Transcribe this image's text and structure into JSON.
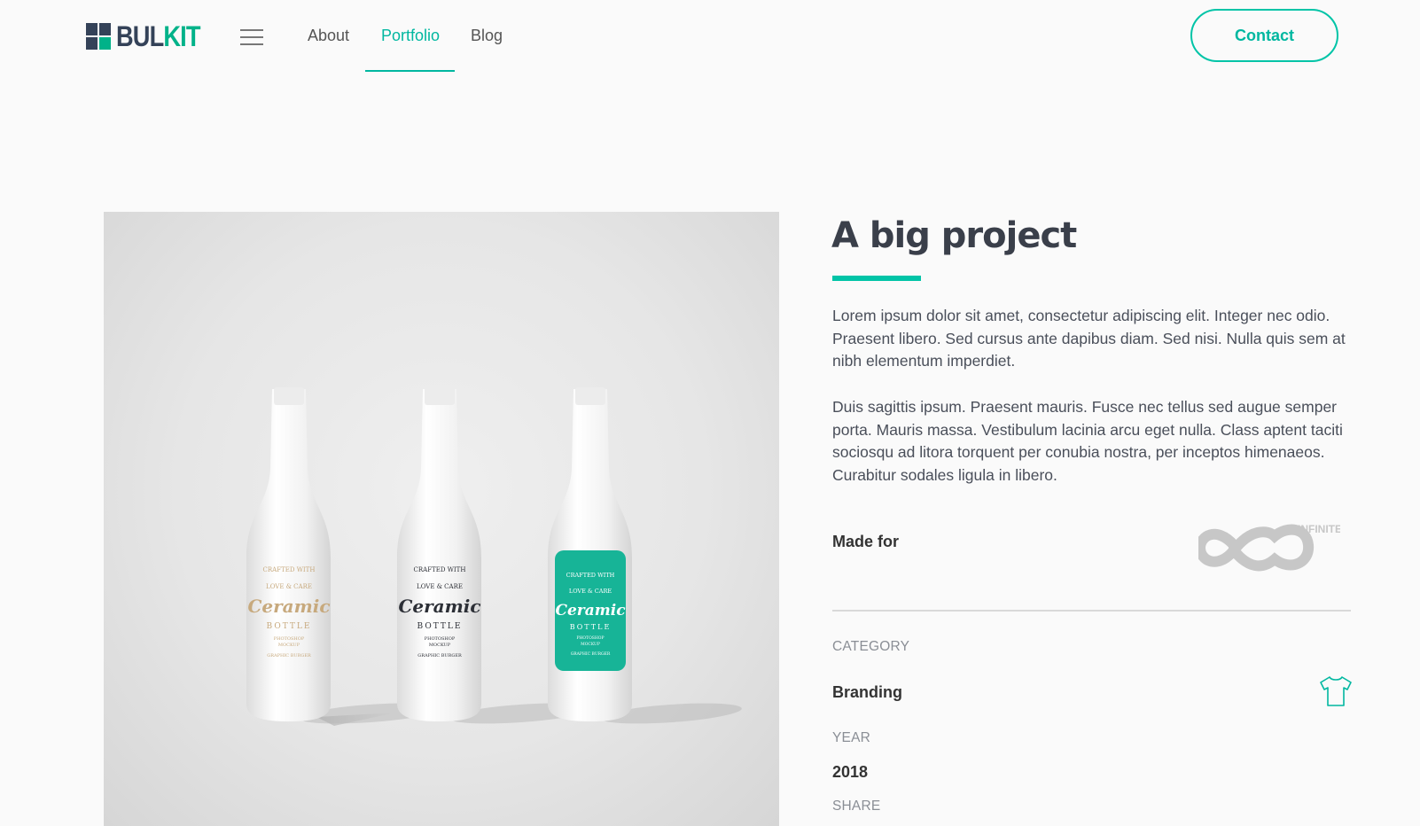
{
  "brand": {
    "part1": "BUL",
    "part2": "KIT"
  },
  "nav": {
    "menu_icon": "hamburger-icon",
    "links": [
      {
        "label": "About",
        "active": false
      },
      {
        "label": "Portfolio",
        "active": true
      },
      {
        "label": "Blog",
        "active": false
      }
    ],
    "contact_label": "Contact"
  },
  "project": {
    "title": "A big project",
    "paragraphs": [
      "Lorem ipsum dolor sit amet, consectetur adipiscing elit. Integer nec odio. Praesent libero. Sed cursus ante dapibus diam. Sed nisi. Nulla quis sem at nibh elementum imperdiet.",
      "Duis sagittis ipsum. Praesent mauris. Fusce nec tellus sed augue semper porta. Mauris massa. Vestibulum lacinia arcu eget nulla. Class aptent taciti sociosqu ad litora torquent per conubia nostra, per inceptos himenaeos. Curabitur sodales ligula in libero."
    ],
    "made_for_label": "Made for",
    "client_logo_text": "INFINITE",
    "category_label": "CATEGORY",
    "category_value": "Branding",
    "category_icon": "tshirt-icon",
    "year_label": "YEAR",
    "year_value": "2018",
    "share_label": "SHARE"
  },
  "image": {
    "bottles": [
      {
        "line1": "CRAFTED WITH",
        "line2": "LOVE & CARE",
        "name": "Ceramic",
        "sub": "BOTTLE",
        "small1": "PHOTOSHOP",
        "small2": "MOCKUP",
        "small3": "GRAPHIC BURGER",
        "variant": "gold"
      },
      {
        "line1": "CRAFTED WITH",
        "line2": "LOVE & CARE",
        "name": "Ceramic",
        "sub": "BOTTLE",
        "small1": "PHOTOSHOP",
        "small2": "MOCKUP",
        "small3": "GRAPHIC BURGER",
        "variant": "dark"
      },
      {
        "line1": "CRAFTED WITH",
        "line2": "LOVE & CARE",
        "name": "Ceramic",
        "sub": "BOTTLE",
        "small1": "PHOTOSHOP",
        "small2": "MOCKUP",
        "small3": "GRAPHIC BURGER",
        "variant": "teal"
      }
    ]
  },
  "colors": {
    "accent": "#00c4a7",
    "brand_dark": "#344258",
    "background": "#fafafa"
  }
}
